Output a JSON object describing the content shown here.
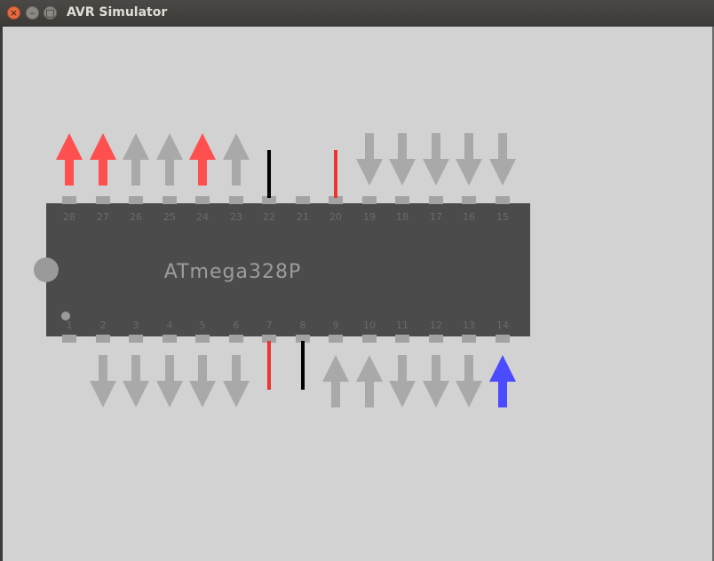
{
  "window": {
    "title": "AVR Simulator"
  },
  "titlebar_buttons": [
    {
      "name": "close",
      "glyph": "×"
    },
    {
      "name": "minimize",
      "glyph": "–"
    },
    {
      "name": "maximize",
      "glyph": "□"
    }
  ],
  "chip": {
    "label": "ATmega328P"
  },
  "colors": {
    "chip_body": "#4b4b4b",
    "pad": "#a3a3a3",
    "inactive": "#a9a9a9",
    "high": "#ff4f4f",
    "input_high": "#4b4bff",
    "ground": "#000000",
    "power": "#ee3333"
  },
  "top_pins": [
    {
      "num": "28",
      "kind": "arrow-up",
      "state": "high"
    },
    {
      "num": "27",
      "kind": "arrow-up",
      "state": "high"
    },
    {
      "num": "26",
      "kind": "arrow-up",
      "state": "inactive"
    },
    {
      "num": "25",
      "kind": "arrow-up",
      "state": "inactive"
    },
    {
      "num": "24",
      "kind": "arrow-up",
      "state": "high"
    },
    {
      "num": "23",
      "kind": "arrow-up",
      "state": "inactive"
    },
    {
      "num": "22",
      "kind": "line",
      "state": "ground"
    },
    {
      "num": "21",
      "kind": "none",
      "state": "none"
    },
    {
      "num": "20",
      "kind": "line",
      "state": "power"
    },
    {
      "num": "19",
      "kind": "arrow-down",
      "state": "inactive"
    },
    {
      "num": "18",
      "kind": "arrow-down",
      "state": "inactive"
    },
    {
      "num": "17",
      "kind": "arrow-down",
      "state": "inactive"
    },
    {
      "num": "16",
      "kind": "arrow-down",
      "state": "inactive"
    },
    {
      "num": "15",
      "kind": "arrow-down",
      "state": "inactive"
    }
  ],
  "bottom_pins": [
    {
      "num": "1",
      "kind": "none",
      "state": "none"
    },
    {
      "num": "2",
      "kind": "arrow-down",
      "state": "inactive"
    },
    {
      "num": "3",
      "kind": "arrow-down",
      "state": "inactive"
    },
    {
      "num": "4",
      "kind": "arrow-down",
      "state": "inactive"
    },
    {
      "num": "5",
      "kind": "arrow-down",
      "state": "inactive"
    },
    {
      "num": "6",
      "kind": "arrow-down",
      "state": "inactive"
    },
    {
      "num": "7",
      "kind": "line",
      "state": "power"
    },
    {
      "num": "8",
      "kind": "line",
      "state": "ground"
    },
    {
      "num": "9",
      "kind": "arrow-up",
      "state": "inactive"
    },
    {
      "num": "10",
      "kind": "arrow-up",
      "state": "inactive"
    },
    {
      "num": "11",
      "kind": "arrow-down",
      "state": "inactive"
    },
    {
      "num": "12",
      "kind": "arrow-down",
      "state": "inactive"
    },
    {
      "num": "13",
      "kind": "arrow-down",
      "state": "inactive"
    },
    {
      "num": "14",
      "kind": "arrow-up",
      "state": "input_high"
    }
  ]
}
